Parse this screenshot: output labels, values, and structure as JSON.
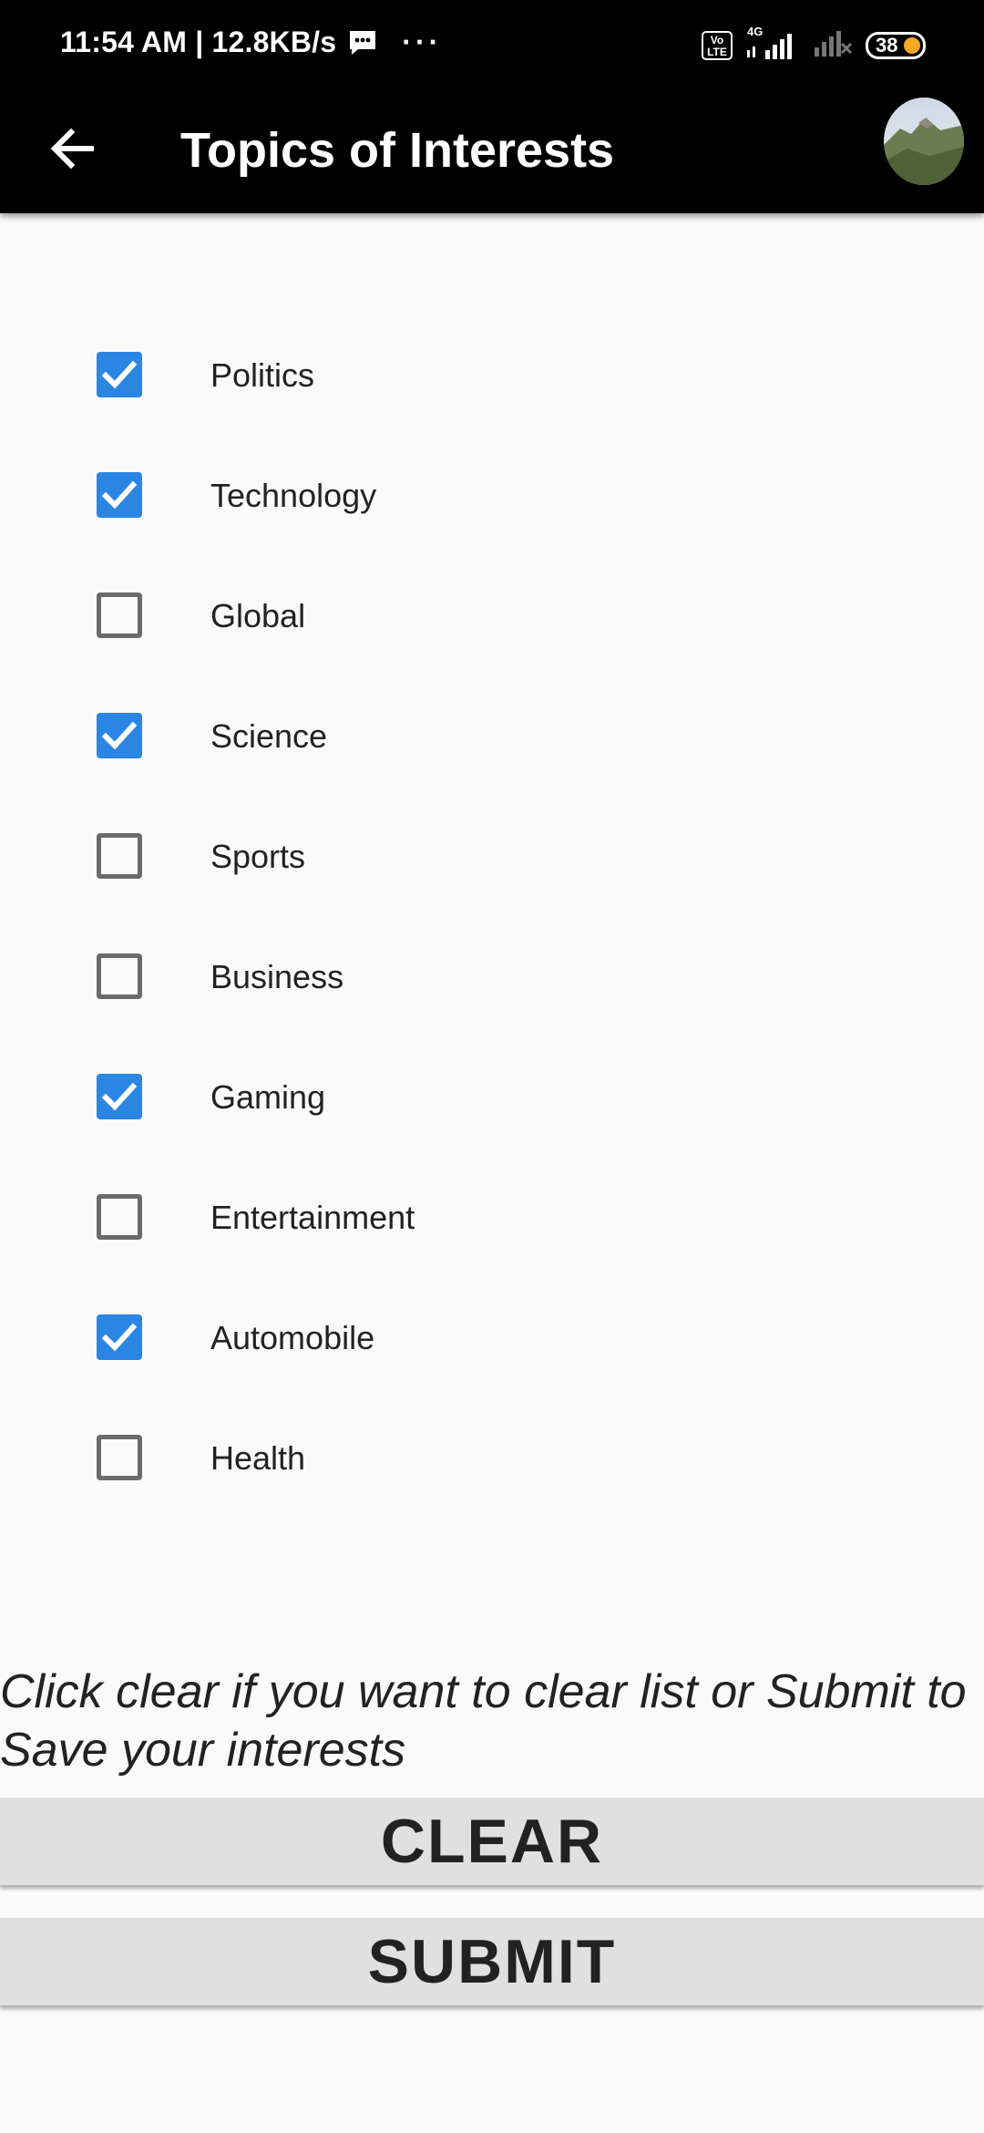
{
  "status_bar": {
    "time_speed": "11:54 AM | 12.8KB/s",
    "more": "···",
    "volte": "Vo LTE",
    "network": "4G",
    "battery": "38",
    "battery_color": "#f5a623",
    "icons": [
      "message-icon",
      "volte-icon",
      "signal-icon",
      "no-signal-icon",
      "battery-icon"
    ]
  },
  "app_bar": {
    "title": "Topics of Interests",
    "back_icon": "arrow-left-icon",
    "avatar": "profile-avatar"
  },
  "topics": [
    {
      "label": "Politics",
      "checked": true
    },
    {
      "label": "Technology",
      "checked": true
    },
    {
      "label": "Global",
      "checked": false
    },
    {
      "label": "Science",
      "checked": true
    },
    {
      "label": "Sports",
      "checked": false
    },
    {
      "label": "Business",
      "checked": false
    },
    {
      "label": "Gaming",
      "checked": true
    },
    {
      "label": "Entertainment",
      "checked": false
    },
    {
      "label": "Automobile",
      "checked": true
    },
    {
      "label": "Health",
      "checked": false
    }
  ],
  "hint": "Click clear if you want to clear list or Submit to Save your interests",
  "buttons": {
    "clear": "CLEAR",
    "submit": "SUBMIT"
  },
  "colors": {
    "checkbox_checked": "#2b86e3",
    "checkbox_unchecked_border": "#6b6b6b",
    "app_bar": "#000000",
    "button_bg": "#e0e0e0"
  }
}
